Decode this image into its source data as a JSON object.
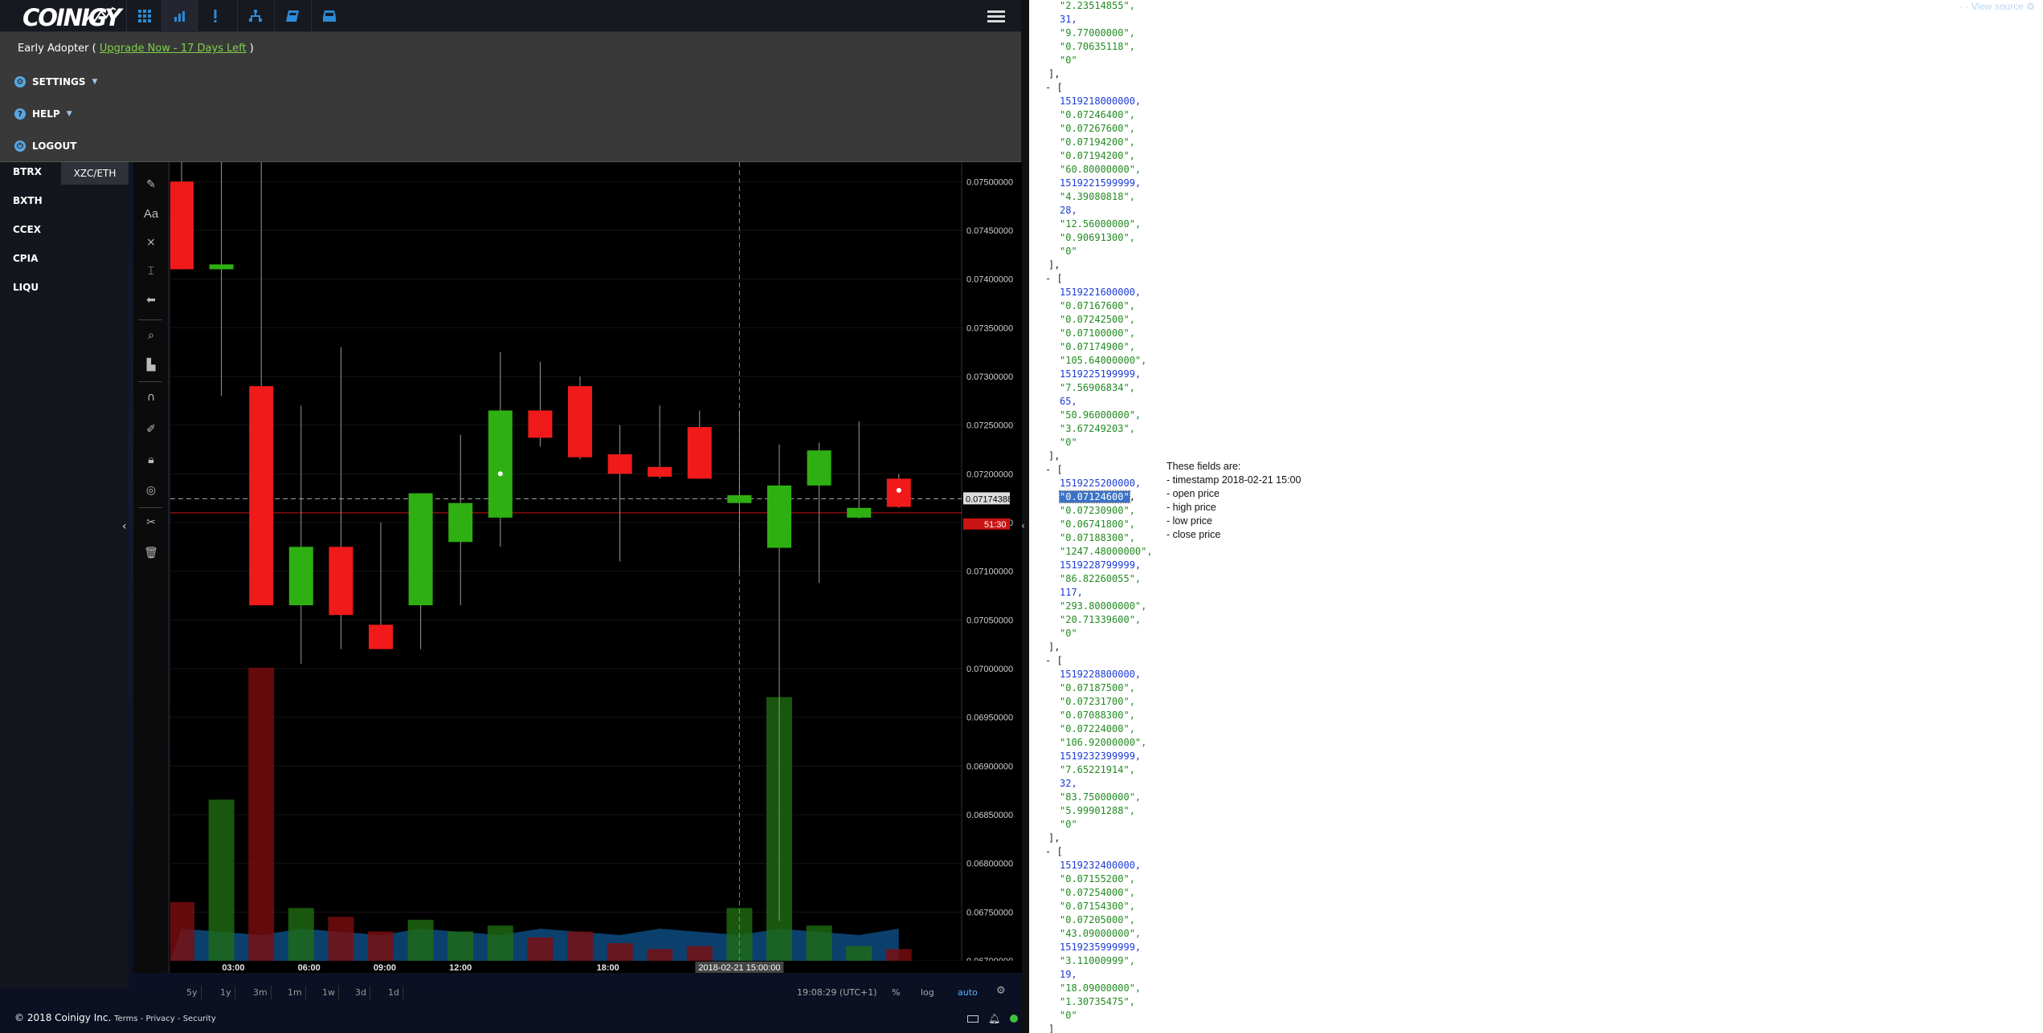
{
  "app": {
    "logo": "COINIGY",
    "account": {
      "prefix": "Early Adopter (",
      "link": "Upgrade Now - 17 Days Left",
      "suffix": ")"
    },
    "menu": [
      {
        "label": "SETTINGS",
        "icon": "gear-icon",
        "has_caret": true
      },
      {
        "label": "HELP",
        "icon": "help-icon",
        "has_caret": true
      },
      {
        "label": "LOGOUT",
        "icon": "power-icon",
        "has_caret": false
      }
    ],
    "exchanges": [
      "BTRX",
      "BXTH",
      "CCEX",
      "CPIA",
      "LIQU"
    ],
    "pair": "XZC/ETH",
    "timeframes": [
      "5y",
      "1y",
      "3m",
      "1m",
      "1w",
      "3d",
      "1d"
    ],
    "chart_clock": "19:08:29 (UTC+1)",
    "controls": [
      "%",
      "log",
      "auto"
    ],
    "footer": {
      "copyright": "© 2018 Coinigy Inc.",
      "links": [
        "Terms",
        "Privacy",
        "Security"
      ]
    }
  },
  "chart_data": {
    "type": "candlestick",
    "x_labels": [
      "03:00",
      "06:00",
      "09:00",
      "12:00",
      "18:00"
    ],
    "crosshair_x_label": "2018-02-21 15:00:00",
    "y_ticks": [
      "0.07500000",
      "0.07450000",
      "0.07400000",
      "0.07350000",
      "0.07300000",
      "0.07250000",
      "0.07200000",
      "0.07150000",
      "0.07100000",
      "0.07050000",
      "0.07000000",
      "0.06950000",
      "0.06900000",
      "0.06850000",
      "0.06800000",
      "0.06750000",
      "0.06700000"
    ],
    "ylim": [
      0.067,
      0.0752
    ],
    "last_price_label": "0.07174388",
    "countdown_label": "51:30",
    "price_line": 0.07174388,
    "red_line": 0.0716,
    "candles": [
      {
        "o": 0.075,
        "h": 0.0752,
        "l": 0.0741,
        "c": 0.0741,
        "v": 0.2
      },
      {
        "o": 0.0741,
        "h": 0.0752,
        "l": 0.0728,
        "c": 0.07415,
        "v": 0.55
      },
      {
        "o": 0.0729,
        "h": 0.0752,
        "l": 0.07065,
        "c": 0.07065,
        "v": 1.0
      },
      {
        "o": 0.07065,
        "h": 0.0727,
        "l": 0.07005,
        "c": 0.07125,
        "v": 0.18
      },
      {
        "o": 0.07125,
        "h": 0.0733,
        "l": 0.0702,
        "c": 0.07055,
        "v": 0.15
      },
      {
        "o": 0.07045,
        "h": 0.0715,
        "l": 0.0702,
        "c": 0.0702,
        "v": 0.1
      },
      {
        "o": 0.07065,
        "h": 0.0718,
        "l": 0.0702,
        "c": 0.0718,
        "v": 0.14
      },
      {
        "o": 0.0713,
        "h": 0.0724,
        "l": 0.07065,
        "c": 0.0717,
        "v": 0.1
      },
      {
        "o": 0.07155,
        "h": 0.07325,
        "l": 0.07125,
        "c": 0.07265,
        "v": 0.12
      },
      {
        "o": 0.07265,
        "h": 0.07315,
        "l": 0.07228,
        "c": 0.07237,
        "v": 0.08
      },
      {
        "o": 0.0729,
        "h": 0.073,
        "l": 0.07215,
        "c": 0.07217,
        "v": 0.1
      },
      {
        "o": 0.0722,
        "h": 0.0725,
        "l": 0.0711,
        "c": 0.072,
        "v": 0.06
      },
      {
        "o": 0.07207,
        "h": 0.0727,
        "l": 0.07195,
        "c": 0.07197,
        "v": 0.04
      },
      {
        "o": 0.07248,
        "h": 0.07265,
        "l": 0.07195,
        "c": 0.07195,
        "v": 0.05
      },
      {
        "o": 0.0717,
        "h": 0.07265,
        "l": 0.071,
        "c": 0.07178,
        "v": 0.18
      },
      {
        "o": 0.07124,
        "h": 0.0723,
        "l": 0.06741,
        "c": 0.07188,
        "v": 0.9
      },
      {
        "o": 0.07188,
        "h": 0.07232,
        "l": 0.07088,
        "c": 0.07224,
        "v": 0.12
      },
      {
        "o": 0.07155,
        "h": 0.07254,
        "l": 0.07154,
        "c": 0.07165,
        "v": 0.05
      },
      {
        "o": 0.07195,
        "h": 0.072,
        "l": 0.07165,
        "c": 0.07166,
        "v": 0.04
      }
    ]
  },
  "json_view": {
    "view_source": "View source",
    "tooltip": [
      "These fields are:",
      "- timestamp 2018-02-21 15:00",
      "- open price",
      "- high price",
      "- low price",
      "- close price"
    ],
    "lines": [
      {
        "t": "str",
        "v": "\"2.23514855\","
      },
      {
        "t": "num",
        "v": "31,"
      },
      {
        "t": "str",
        "v": "\"9.77000000\","
      },
      {
        "t": "str",
        "v": "\"0.70635118\","
      },
      {
        "t": "str",
        "v": "\"0\""
      },
      {
        "t": "close",
        "v": "],"
      },
      {
        "t": "open",
        "v": "- ["
      },
      {
        "t": "num",
        "v": "1519218000000,"
      },
      {
        "t": "str",
        "v": "\"0.07246400\","
      },
      {
        "t": "str",
        "v": "\"0.07267600\","
      },
      {
        "t": "str",
        "v": "\"0.07194200\","
      },
      {
        "t": "str",
        "v": "\"0.07194200\","
      },
      {
        "t": "str",
        "v": "\"60.80000000\","
      },
      {
        "t": "num",
        "v": "1519221599999,"
      },
      {
        "t": "str",
        "v": "\"4.39080818\","
      },
      {
        "t": "num",
        "v": "28,"
      },
      {
        "t": "str",
        "v": "\"12.56000000\","
      },
      {
        "t": "str",
        "v": "\"0.90691300\","
      },
      {
        "t": "str",
        "v": "\"0\""
      },
      {
        "t": "close",
        "v": "],"
      },
      {
        "t": "open",
        "v": "- ["
      },
      {
        "t": "num",
        "v": "1519221600000,"
      },
      {
        "t": "str",
        "v": "\"0.07167600\","
      },
      {
        "t": "str",
        "v": "\"0.07242500\","
      },
      {
        "t": "str",
        "v": "\"0.07100000\","
      },
      {
        "t": "str",
        "v": "\"0.07174900\","
      },
      {
        "t": "str",
        "v": "\"105.64000000\","
      },
      {
        "t": "num",
        "v": "1519225199999,"
      },
      {
        "t": "str",
        "v": "\"7.56906834\","
      },
      {
        "t": "num",
        "v": "65,"
      },
      {
        "t": "str",
        "v": "\"50.96000000\","
      },
      {
        "t": "str",
        "v": "\"3.67249203\","
      },
      {
        "t": "str",
        "v": "\"0\""
      },
      {
        "t": "close",
        "v": "],"
      },
      {
        "t": "open",
        "v": "- ["
      },
      {
        "t": "num",
        "v": "1519225200000,"
      },
      {
        "t": "hl",
        "v": "\"0.07124600\","
      },
      {
        "t": "str",
        "v": "\"0.07230900\","
      },
      {
        "t": "str",
        "v": "\"0.06741800\","
      },
      {
        "t": "str",
        "v": "\"0.07188300\","
      },
      {
        "t": "str",
        "v": "\"1247.48000000\","
      },
      {
        "t": "num",
        "v": "1519228799999,"
      },
      {
        "t": "str",
        "v": "\"86.82260055\","
      },
      {
        "t": "num",
        "v": "117,"
      },
      {
        "t": "str",
        "v": "\"293.80000000\","
      },
      {
        "t": "str",
        "v": "\"20.71339600\","
      },
      {
        "t": "str",
        "v": "\"0\""
      },
      {
        "t": "close",
        "v": "],"
      },
      {
        "t": "open",
        "v": "- ["
      },
      {
        "t": "num",
        "v": "1519228800000,"
      },
      {
        "t": "str",
        "v": "\"0.07187500\","
      },
      {
        "t": "str",
        "v": "\"0.07231700\","
      },
      {
        "t": "str",
        "v": "\"0.07088300\","
      },
      {
        "t": "str",
        "v": "\"0.07224000\","
      },
      {
        "t": "str",
        "v": "\"106.92000000\","
      },
      {
        "t": "num",
        "v": "1519232399999,"
      },
      {
        "t": "str",
        "v": "\"7.65221914\","
      },
      {
        "t": "num",
        "v": "32,"
      },
      {
        "t": "str",
        "v": "\"83.75000000\","
      },
      {
        "t": "str",
        "v": "\"5.99901288\","
      },
      {
        "t": "str",
        "v": "\"0\""
      },
      {
        "t": "close",
        "v": "],"
      },
      {
        "t": "open",
        "v": "- ["
      },
      {
        "t": "num",
        "v": "1519232400000,"
      },
      {
        "t": "str",
        "v": "\"0.07155200\","
      },
      {
        "t": "str",
        "v": "\"0.07254000\","
      },
      {
        "t": "str",
        "v": "\"0.07154300\","
      },
      {
        "t": "str",
        "v": "\"0.07205000\","
      },
      {
        "t": "str",
        "v": "\"43.09000000\","
      },
      {
        "t": "num",
        "v": "1519235999999,"
      },
      {
        "t": "str",
        "v": "\"3.11000999\","
      },
      {
        "t": "num",
        "v": "19,"
      },
      {
        "t": "str",
        "v": "\"18.09000000\","
      },
      {
        "t": "str",
        "v": "\"1.30735475\","
      },
      {
        "t": "str",
        "v": "\"0\""
      },
      {
        "t": "close",
        "v": "]"
      }
    ]
  }
}
